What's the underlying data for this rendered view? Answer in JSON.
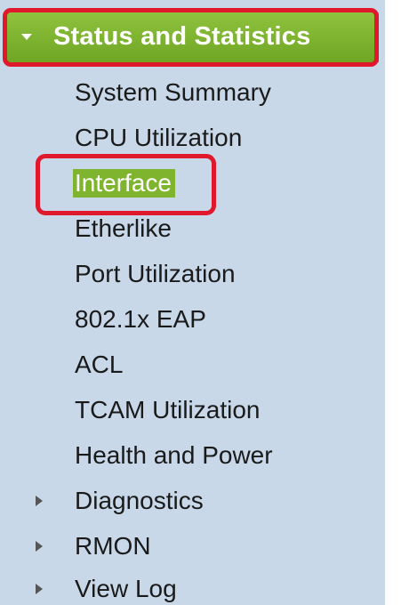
{
  "section": {
    "title": "Status and Statistics",
    "expanded_icon": "triangle-down-icon"
  },
  "items": [
    {
      "label": "System Summary"
    },
    {
      "label": "CPU Utilization"
    },
    {
      "label": "Interface",
      "selected": true
    },
    {
      "label": "Etherlike"
    },
    {
      "label": "Port Utilization"
    },
    {
      "label": "802.1x EAP"
    },
    {
      "label": "ACL"
    },
    {
      "label": "TCAM Utilization"
    },
    {
      "label": "Health and Power"
    }
  ],
  "collapsed_sections": [
    {
      "label": "Diagnostics",
      "icon": "triangle-right-icon"
    },
    {
      "label": "RMON",
      "icon": "triangle-right-icon"
    },
    {
      "label": "View Log",
      "icon": "triangle-right-icon"
    }
  ],
  "colors": {
    "panel_bg": "#c8d8e8",
    "accent_green": "#7fb52e",
    "highlight_red": "#e0182b"
  }
}
